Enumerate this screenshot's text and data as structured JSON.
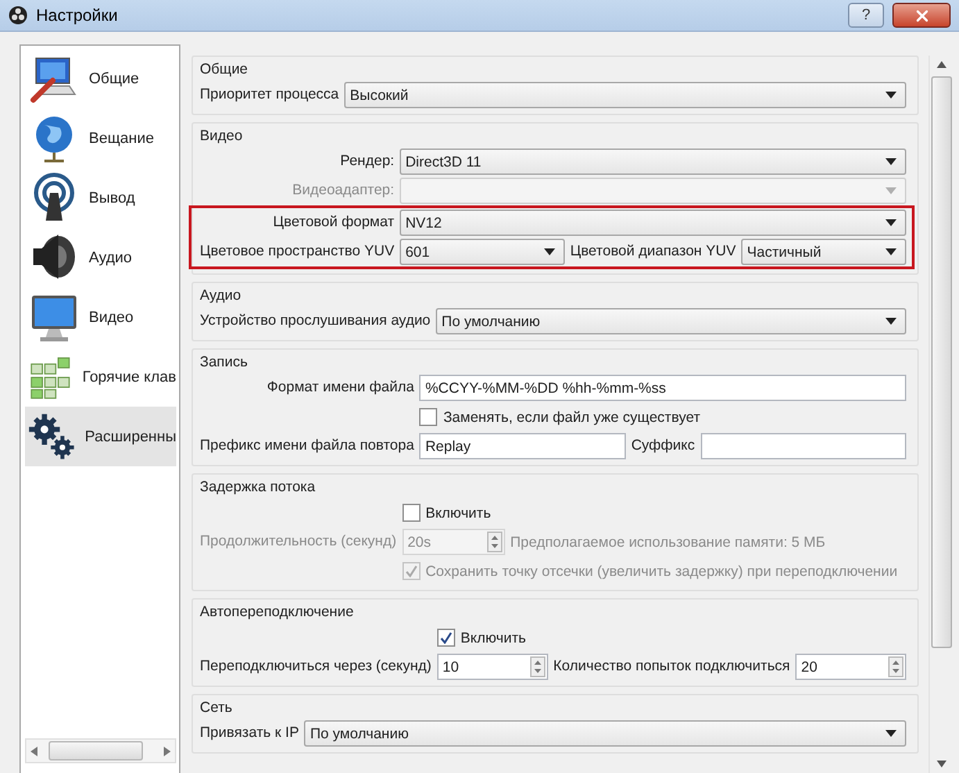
{
  "window": {
    "title": "Настройки",
    "help": "?"
  },
  "sidebar": {
    "items": [
      {
        "label": "Общие",
        "kind": "general",
        "selected": false
      },
      {
        "label": "Вещание",
        "kind": "stream",
        "selected": false
      },
      {
        "label": "Вывод",
        "kind": "output",
        "selected": false
      },
      {
        "label": "Аудио",
        "kind": "audio",
        "selected": false
      },
      {
        "label": "Видео",
        "kind": "video",
        "selected": false
      },
      {
        "label": "Горячие клав",
        "kind": "hotkeys",
        "selected": false
      },
      {
        "label": "Расширенны",
        "kind": "advanced",
        "selected": true
      }
    ]
  },
  "sections": [
    {
      "title": "Общие",
      "rows": [
        {
          "kind": "select",
          "label": "Приоритет процесса",
          "value": "Высокий",
          "disabled": false
        }
      ]
    },
    {
      "title": "Видео",
      "rows": [
        {
          "kind": "select",
          "label": "Рендер:",
          "value": "Direct3D 11",
          "disabled": false,
          "highlighted": false
        },
        {
          "kind": "select",
          "label": "Видеоадаптер:",
          "disabled": true,
          "highlighted": false
        },
        {
          "kind": "select",
          "label": "Цветовой формат",
          "value": "NV12",
          "disabled": false,
          "highlighted": true
        },
        {
          "kind": "select_pair",
          "label": "Цветовое пространство YUV",
          "value": "601",
          "label2": "Цветовой диапазон YUV",
          "value2": "Частичный",
          "disabled": false,
          "highlighted": true
        }
      ]
    },
    {
      "title": "Аудио",
      "rows": [
        {
          "kind": "select",
          "label": "Устройство прослушивания аудио",
          "value": "По умолчанию",
          "disabled": false
        }
      ]
    },
    {
      "title": "Запись",
      "rows": [
        {
          "kind": "text",
          "label": "Формат имени файла",
          "value": "%CCYY-%MM-%DD %hh-%mm-%ss"
        },
        {
          "kind": "checkbox",
          "label": "Заменять, если файл уже существует",
          "checked": false,
          "disabled": false
        },
        {
          "kind": "text_pair",
          "label": "Префикс имени файла повтора",
          "value": "Replay",
          "label2": "Суффикс"
        }
      ]
    },
    {
      "title": "Задержка потока",
      "rows": [
        {
          "kind": "checkbox",
          "label": "Включить",
          "checked": false,
          "disabled": false
        },
        {
          "kind": "spin",
          "label": "Продолжительность (секунд)",
          "value": "20s",
          "note": "Предполагаемое использование памяти: 5 МБ",
          "disabled": true
        },
        {
          "kind": "checkbox",
          "label": "Сохранить точку отсечки (увеличить задержку) при переподключении",
          "checked": true,
          "disabled": true
        }
      ]
    },
    {
      "title": "Автопереподключение",
      "rows": [
        {
          "kind": "checkbox",
          "label": "Включить",
          "checked": true,
          "disabled": false
        },
        {
          "kind": "spin_pair",
          "label": "Переподключиться через (секунд)",
          "value": "10",
          "label2": "Количество попыток подключиться",
          "value2": "20",
          "disabled": false
        }
      ]
    },
    {
      "title": "Сеть",
      "rows": [
        {
          "kind": "select",
          "label": "Привязать к IP",
          "value": "По умолчанию",
          "disabled": false
        }
      ]
    }
  ]
}
